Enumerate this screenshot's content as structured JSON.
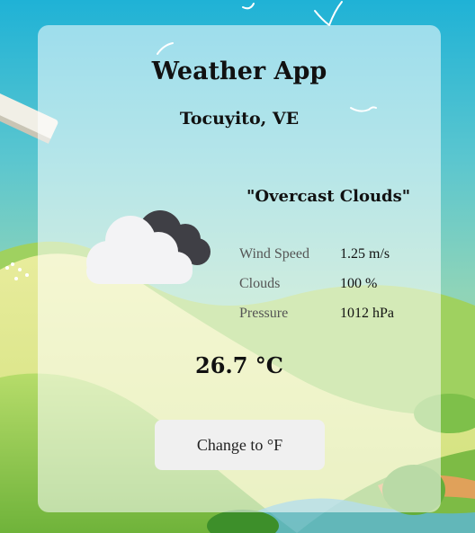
{
  "app": {
    "title": "Weather App",
    "location": "Tocuyito, VE"
  },
  "weather": {
    "description": "\"Overcast Clouds\"",
    "icon": "overcast-clouds-icon",
    "temperature": "26.7 °C",
    "stats": [
      {
        "label": "Wind Speed",
        "value": "1.25 m/s"
      },
      {
        "label": "Clouds",
        "value": "100 %"
      },
      {
        "label": "Pressure",
        "value": "1012 hPa"
      }
    ]
  },
  "controls": {
    "unit_toggle_label": "Change to °F"
  },
  "colors": {
    "sky": "#1fb2d6",
    "hills": "#a9d878",
    "card_bg": "rgba(255,255,255,0.55)",
    "button_bg": "#f0f0f0"
  }
}
